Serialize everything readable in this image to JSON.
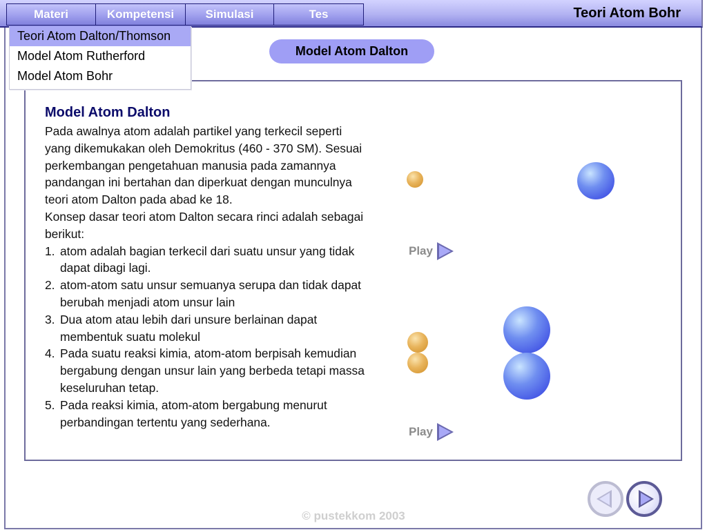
{
  "header": {
    "nav_tabs": [
      {
        "label": "Materi"
      },
      {
        "label": "Kompetensi"
      },
      {
        "label": "Simulasi"
      },
      {
        "label": "Tes"
      }
    ],
    "title": "Teori Atom Bohr"
  },
  "dropdown": {
    "items": [
      {
        "label": "Teori Atom Dalton/Thomson",
        "active": true
      },
      {
        "label": "Model Atom Rutherford",
        "active": false
      },
      {
        "label": "Model Atom Bohr",
        "active": false
      }
    ]
  },
  "section_pill": "Model Atom Dalton",
  "content": {
    "heading": "Model Atom Dalton",
    "intro": "Pada awalnya atom adalah partikel yang terkecil seperti yang dikemukakan oleh Demokritus (460 - 370 SM). Sesuai perkembangan pengetahuan manusia pada zamannya pandangan ini bertahan dan diperkuat dengan  munculnya teori atom Dalton pada abad ke 18.",
    "concept_intro": "Konsep dasar teori atom Dalton secara rinci adalah sebagai berikut:",
    "points": [
      {
        "num": "1.",
        "text": "atom adalah bagian terkecil dari suatu unsur yang tidak dapat dibagi lagi."
      },
      {
        "num": "2.",
        "text": "atom-atom satu unsur semuanya serupa dan tidak dapat berubah menjadi atom unsur lain"
      },
      {
        "num": "3.",
        "text": "Dua atom atau lebih dari unsure berlainan dapat membentuk suatu molekul"
      },
      {
        "num": "4.",
        "text": "Pada suatu reaksi kimia, atom-atom berpisah kemudian bergabung dengan unsur lain yang berbeda tetapi massa keseluruhan tetap."
      },
      {
        "num": "5.",
        "text": "Pada reaksi kimia, atom-atom bergabung menurut perbandingan tertentu yang sederhana."
      }
    ]
  },
  "animations": [
    {
      "play_label": "Play"
    },
    {
      "play_label": "Play"
    }
  ],
  "colors": {
    "accent": "#9f9ef5",
    "heading": "#0b0b6a",
    "atom_small": "#e8b45c",
    "atom_big": "#4f62e8"
  },
  "footer": {
    "copyright": "© pustekkom 2003"
  }
}
